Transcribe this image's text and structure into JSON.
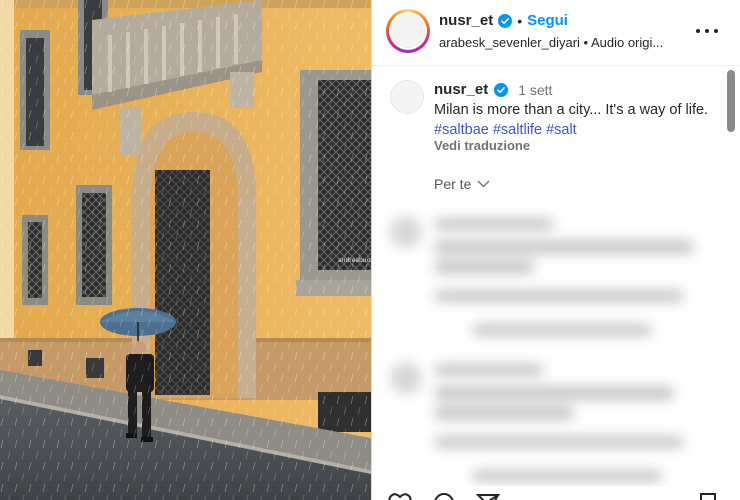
{
  "post": {
    "username": "nusr_et",
    "follow_label": "Segui",
    "separator": "•",
    "audio_line": "arabesk_sevenler_diyari • Audio origi..."
  },
  "caption": {
    "username": "nusr_et",
    "time": "1 sett",
    "text_before": "Milan is more than a city... It's a way of life.",
    "hashtags": [
      "#saltbae",
      "#saltlife",
      "#salt"
    ],
    "translate_label": "Vedi traduzione"
  },
  "comments_filter": {
    "label": "Per te"
  },
  "photo": {
    "door_plate": "andreabuongarzone"
  },
  "colors": {
    "accent": "#0095f6",
    "hashtag": "#3b56c9",
    "verified": "#0095f6",
    "facade": "#e8b35c"
  },
  "icons": [
    "verified-icon",
    "more-options-icon",
    "chevron-down-icon",
    "heart-icon",
    "comment-icon",
    "share-icon",
    "bookmark-icon"
  ]
}
